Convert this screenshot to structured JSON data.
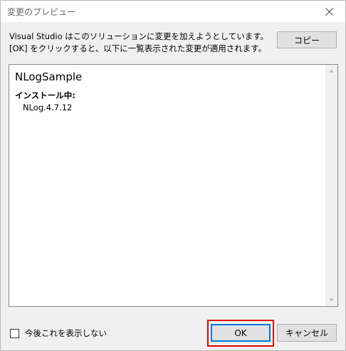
{
  "window": {
    "title": "変更のプレビュー",
    "close_icon": "close-icon"
  },
  "description": "Visual Studio はこのソリューションに変更を加えようとしています。[OK] をクリックすると、以下に一覧表示された変更が適用されます。",
  "buttons": {
    "copy": "コピー",
    "ok": "OK",
    "cancel": "キャンセル"
  },
  "preview": {
    "project": "NLogSample",
    "section": "インストール中:",
    "packages": [
      "NLog.4.7.12"
    ]
  },
  "checkbox": {
    "label": "今後これを表示しない",
    "checked": false
  },
  "colors": {
    "highlight": "#e00000",
    "focus": "#0078d7"
  }
}
